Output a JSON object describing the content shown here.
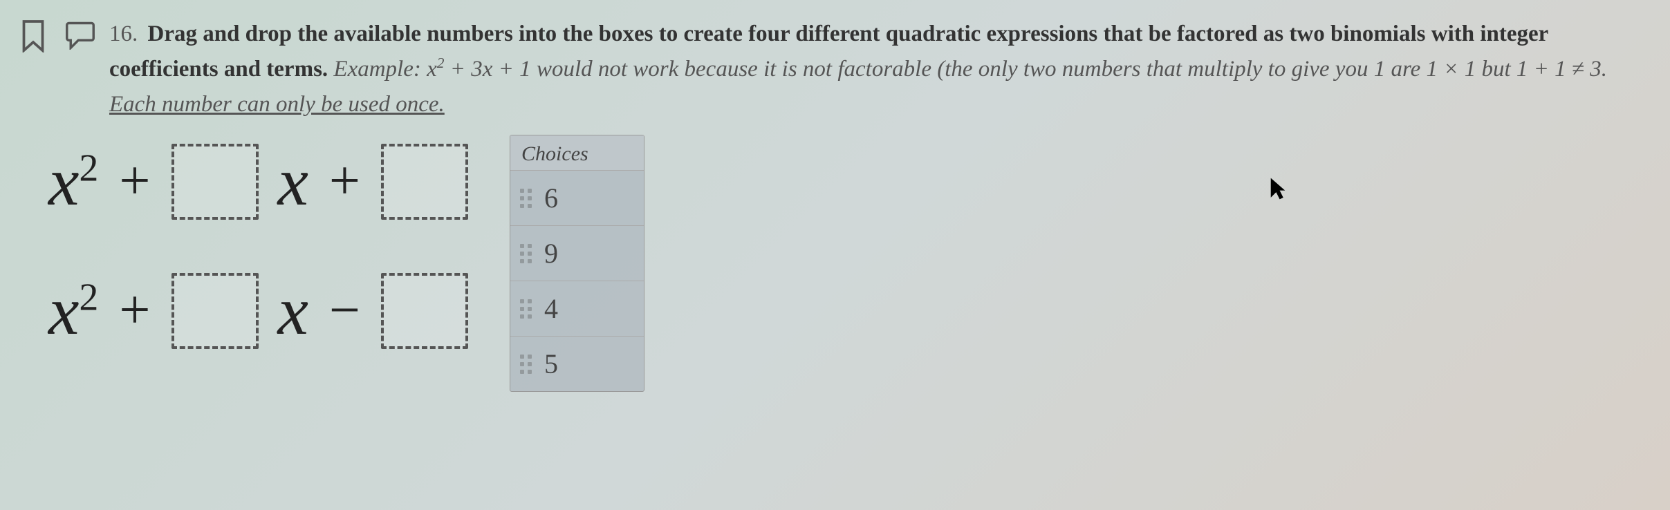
{
  "question": {
    "number": "16.",
    "prompt_bold": "Drag and drop the available numbers into the boxes to create four different quadratic expressions that be factored as two binomials with integer coefficients and terms.",
    "example_label": "Example:",
    "example_expr_pre": "x",
    "example_expr_sup": "2",
    "example_expr_mid": " + 3x + 1",
    "example_tail": " would not work because it is not factorable (the only two numbers that multiply to give you 1 are 1 × 1 but 1 + 1 ≠ 3.",
    "underline_note": "Each number can only be used once."
  },
  "expressions": [
    {
      "lead_op": "+",
      "tail_op": "+"
    },
    {
      "lead_op": "+",
      "tail_op": "−"
    }
  ],
  "choices": {
    "header": "Choices",
    "items": [
      "6",
      "9",
      "4",
      "5"
    ]
  },
  "chart_data": {
    "type": "table",
    "title": "Available numbers for drag-and-drop",
    "values": [
      6,
      9,
      4,
      5
    ]
  }
}
